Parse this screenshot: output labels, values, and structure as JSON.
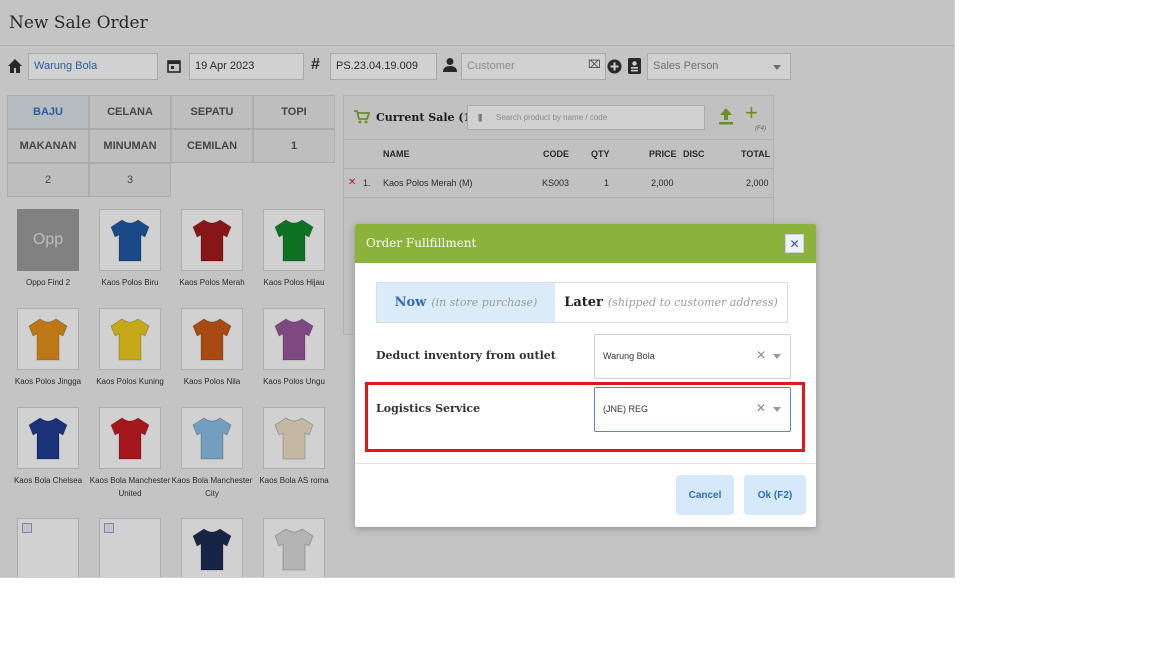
{
  "page": {
    "title": "New Sale Order"
  },
  "toolbar": {
    "outlet": "Warung Bola",
    "date": "19 Apr 2023",
    "order_number": "PS.23.04.19.009",
    "customer_placeholder": "Customer",
    "sales_person_placeholder": "Sales Person"
  },
  "categories": [
    "BAJU",
    "CELANA",
    "SEPATU",
    "TOPI",
    "MAKANAN",
    "MINUMAN",
    "CEMILAN",
    "1",
    "2",
    "3"
  ],
  "products": [
    {
      "name": "Oppo Find 2",
      "thumb": "Opp",
      "color": ""
    },
    {
      "name": "Kaos Polos Biru",
      "color": "#1f5aa6"
    },
    {
      "name": "Kaos Polos Merah",
      "color": "#a51d1d"
    },
    {
      "name": "Kaos Polos Hijau",
      "color": "#138a2c"
    },
    {
      "name": "Kaos Polos Jingga",
      "color": "#e8921a"
    },
    {
      "name": "Kaos Polos Kuning",
      "color": "#f2cf1f"
    },
    {
      "name": "Kaos Polos Nila",
      "color": "#cf5a17"
    },
    {
      "name": "Kaos Polos Ungu",
      "color": "#9a5aa0"
    },
    {
      "name": "Kaos Bola Chelsea",
      "color": "#1f3d93"
    },
    {
      "name": "Kaos Bola Manchester United",
      "color": "#c81d24"
    },
    {
      "name": "Kaos Bola Manchester City",
      "color": "#8ec1ea"
    },
    {
      "name": "Kaos Bola AS roma",
      "color": "#efe1c7"
    },
    {
      "name": "",
      "color": ""
    },
    {
      "name": "",
      "color": ""
    },
    {
      "name": "",
      "color": "#1c2e55"
    },
    {
      "name": "",
      "color": "#dcdcdc"
    }
  ],
  "sale": {
    "title": "Current Sale (1)",
    "search_placeholder": "Search product by name / code",
    "shortcut": "(F4)",
    "headers": {
      "name": "NAME",
      "code": "CODE",
      "qty": "QTY",
      "price": "PRICE",
      "disc": "DISC",
      "total": "TOTAL"
    },
    "items": [
      {
        "no": "1.",
        "name": "Kaos Polos Merah (M)",
        "code": "KS003",
        "qty": "1",
        "price": "2,000",
        "disc": "",
        "total": "2,000"
      }
    ]
  },
  "modal": {
    "title": "Order Fullfillment",
    "now_label": "Now",
    "now_sub": "(in store purchase)",
    "later_label": "Later",
    "later_sub": "(shipped to customer address)",
    "deduct_label": "Deduct inventory from outlet",
    "deduct_value": "Warung Bola",
    "logistics_label": "Logistics Service",
    "logistics_value": "(JNE) REG",
    "cancel_label": "Cancel",
    "ok_label": "Ok (F2)"
  },
  "colors": {
    "accent_green": "#8bb23b",
    "highlight_red": "#e5161b",
    "link_blue": "#2f74c7"
  }
}
